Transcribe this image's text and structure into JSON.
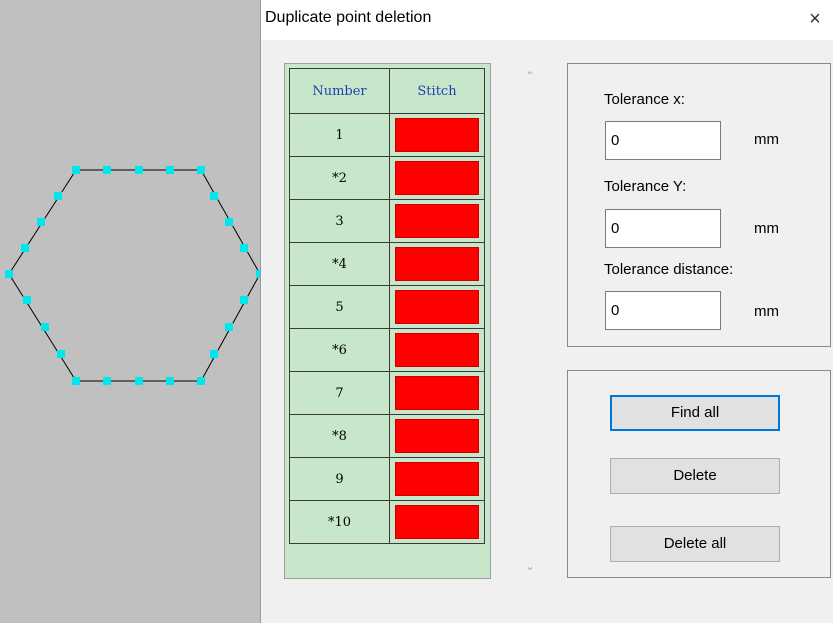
{
  "dialog": {
    "title": "Duplicate point deletion",
    "close_symbol": "×"
  },
  "table": {
    "headers": {
      "number": "Number",
      "stitch": "Stitch"
    },
    "rows": [
      {
        "number": "1",
        "stitch_color": "#ff0000"
      },
      {
        "number": "*2",
        "stitch_color": "#ff0000"
      },
      {
        "number": "3",
        "stitch_color": "#ff0000"
      },
      {
        "number": "*4",
        "stitch_color": "#ff0000"
      },
      {
        "number": "5",
        "stitch_color": "#ff0000"
      },
      {
        "number": "*6",
        "stitch_color": "#ff0000"
      },
      {
        "number": "7",
        "stitch_color": "#ff0000"
      },
      {
        "number": "*8",
        "stitch_color": "#ff0000"
      },
      {
        "number": "9",
        "stitch_color": "#ff0000"
      },
      {
        "number": "*10",
        "stitch_color": "#ff0000"
      }
    ]
  },
  "tolerance": {
    "x_label": "Tolerance x:",
    "x_value": "0",
    "x_unit": "mm",
    "y_label": "Tolerance Y:",
    "y_value": "0",
    "y_unit": "mm",
    "dist_label": "Tolerance distance:",
    "dist_value": "0",
    "dist_unit": "mm"
  },
  "buttons": {
    "find_all": "Find all",
    "delete": "Delete",
    "delete_all": "Delete all"
  },
  "colors": {
    "canvas_bg": "#c0c0c0",
    "shape_line": "#000000",
    "stitch_point": "#00e5ee",
    "table_bg": "#c8e6c9",
    "stitch_swatch": "#ff0000",
    "header_text": "#1f3fb5",
    "focus_border": "#0078d7"
  }
}
